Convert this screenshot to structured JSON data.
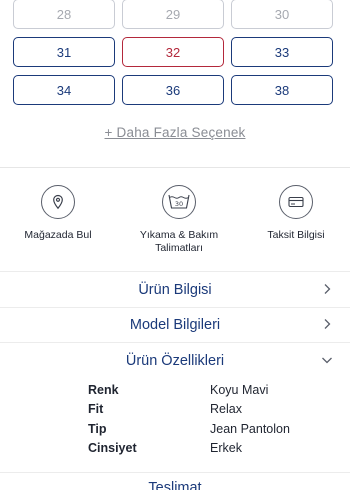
{
  "sizes": {
    "row1": [
      {
        "label": "28",
        "state": "disabled"
      },
      {
        "label": "29",
        "state": "disabled"
      },
      {
        "label": "30",
        "state": "disabled"
      }
    ],
    "row2": [
      {
        "label": "31",
        "state": "available"
      },
      {
        "label": "32",
        "state": "selected"
      },
      {
        "label": "33",
        "state": "available"
      }
    ],
    "row3": [
      {
        "label": "34",
        "state": "available"
      },
      {
        "label": "36",
        "state": "available"
      },
      {
        "label": "38",
        "state": "available"
      }
    ]
  },
  "more_options": "+ Daha Fazla Seçenek",
  "features": {
    "store": {
      "label": "Mağazada Bul",
      "icon": "location-pin-icon"
    },
    "care": {
      "label": "Yıkama & Bakım Talimatları",
      "icon": "wash-30-icon",
      "badge": "30"
    },
    "installment": {
      "label": "Taksit Bilgisi",
      "icon": "credit-card-icon"
    }
  },
  "accordion": {
    "product_info": "Ürün Bilgisi",
    "model_info": "Model Bilgileri",
    "product_features": "Ürün Özellikleri"
  },
  "specs": [
    {
      "key": "Renk",
      "value": "Koyu Mavi"
    },
    {
      "key": "Fit",
      "value": "Relax"
    },
    {
      "key": "Tip",
      "value": "Jean Pantolon"
    },
    {
      "key": "Cinsiyet",
      "value": "Erkek"
    }
  ],
  "delivery": "Teslimat",
  "colors": {
    "primary": "#1b3a7a",
    "selected": "#b3283b",
    "disabled": "#a6a9b0"
  }
}
